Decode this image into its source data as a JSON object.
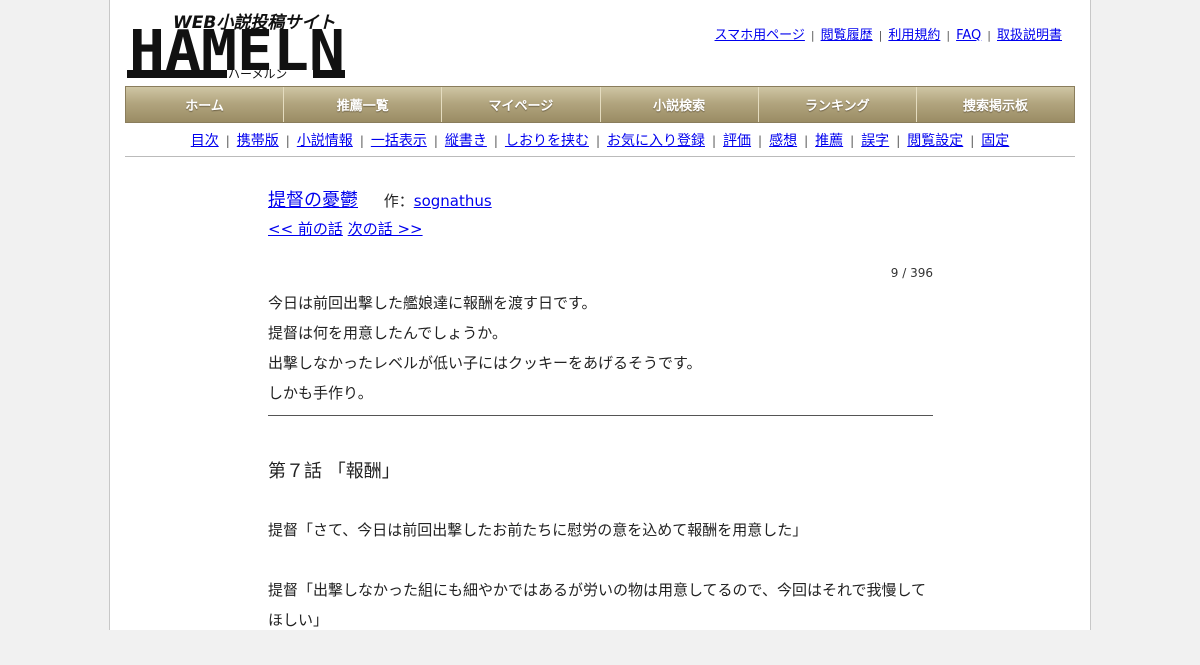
{
  "site": {
    "tagline": "WEB小説投稿サイト",
    "logo_text": "HAMELN",
    "logo_kana": "ハーメルン"
  },
  "top_links": [
    "スマホ用ページ",
    "閲覧履歴",
    "利用規約",
    "FAQ",
    "取扱説明書"
  ],
  "nav": [
    "ホーム",
    "推薦一覧",
    "マイページ",
    "小説検索",
    "ランキング",
    "捜索掲示板"
  ],
  "sub_links": [
    "目次",
    "携帯版",
    "小説情報",
    "一括表示",
    "縦書き",
    "しおりを挟む",
    "お気に入り登録",
    "評価",
    "感想",
    "推薦",
    "誤字",
    "閲覧設定",
    "固定"
  ],
  "novel": {
    "title": "提督の憂鬱",
    "author_prefix": "作：",
    "author": "sognathus",
    "prev": "<< 前の話",
    "next": "次の話 >>",
    "counter": "9 / 396",
    "preface": [
      "今日は前回出撃した艦娘達に報酬を渡す日です。",
      "提督は何を用意したんでしょうか。",
      "出撃しなかったレベルが低い子にはクッキーをあげるそうです。",
      "しかも手作り。"
    ],
    "chapter_title": "第７話 「報酬」",
    "body": [
      "提督「さて、今日は前回出撃したお前たちに慰労の意を込めて報酬を用意した」",
      "提督「出撃しなかった組にも細やかではあるが労いの物は用意してるので、今回はそれで我慢してほしい」"
    ]
  },
  "colors": {
    "link": "#0000ee",
    "nav_bg": "#b2a57f",
    "nav_text": "#ffffff"
  }
}
